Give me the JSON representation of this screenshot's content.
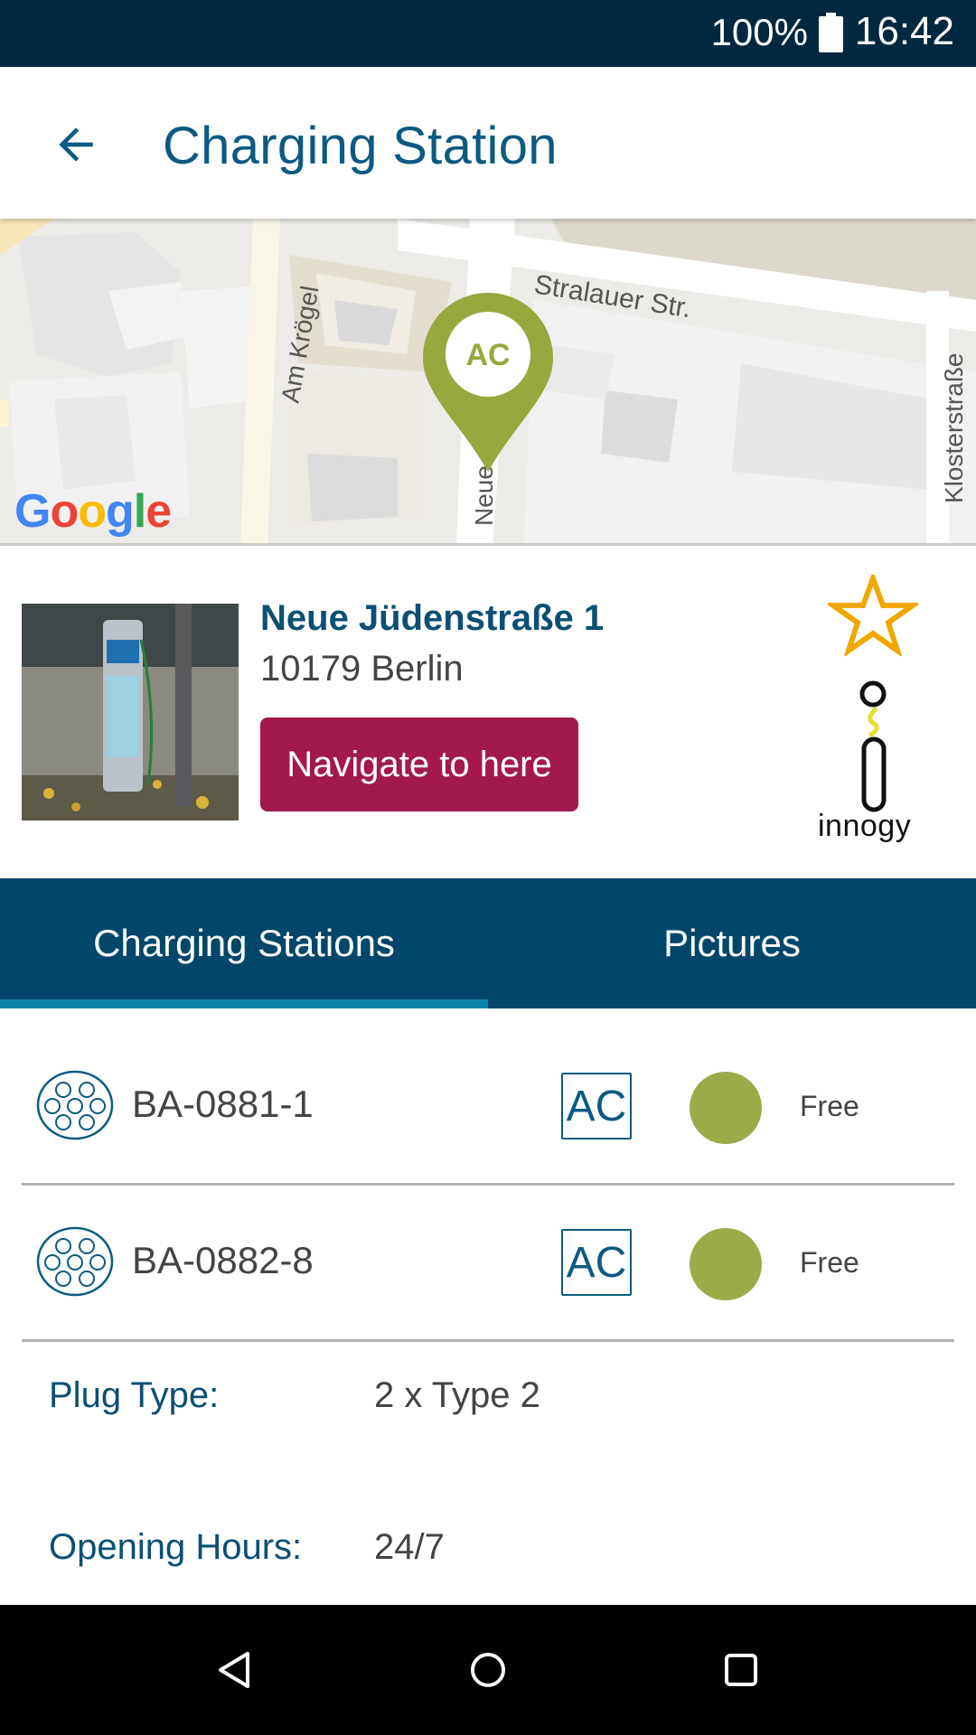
{
  "status_bar": {
    "battery_text": "100%",
    "battery_icon": "battery-full-icon",
    "time": "16:42"
  },
  "app_bar": {
    "back_icon": "arrow-back-icon",
    "title": "Charging Station"
  },
  "map": {
    "streets": [
      "Stralauer Str.",
      "Am Krögel",
      "Neue",
      "Klosterstraße"
    ],
    "marker_label": "AC",
    "provider_logo": "Google",
    "marker_color": "#97a83e"
  },
  "station": {
    "street": "Neue Jüdenstraße 1",
    "city": "10179 Berlin",
    "navigate_label": "Navigate to here",
    "favorite_icon": "star-outline-icon",
    "operator_logo": "innogy",
    "accent_color": "#a3194e",
    "star_color": "#f0a800"
  },
  "tabs": [
    {
      "label": "Charging Stations",
      "active": true
    },
    {
      "label": "Pictures",
      "active": false
    }
  ],
  "charge_points": [
    {
      "id": "BA-0881-1",
      "plug_icon": "type2-plug-icon",
      "current": "AC",
      "status": "Free",
      "status_color": "#9aab48"
    },
    {
      "id": "BA-0882-8",
      "plug_icon": "type2-plug-icon",
      "current": "AC",
      "status": "Free",
      "status_color": "#9aab48"
    }
  ],
  "details": {
    "plug_type_label": "Plug Type:",
    "plug_type_value": "2 x Type 2",
    "hours_label": "Opening Hours:",
    "hours_value": "24/7"
  },
  "nav_bar": {
    "back_icon": "nav-back-triangle-icon",
    "home_icon": "nav-home-circle-icon",
    "recents_icon": "nav-recents-square-icon"
  }
}
